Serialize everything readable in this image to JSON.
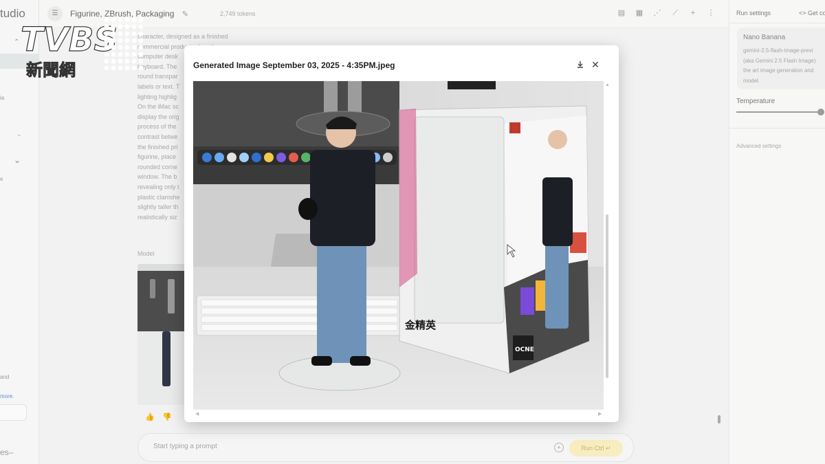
{
  "app": {
    "brand": "tudio",
    "title": "Figurine, ZBrush, Packaging",
    "tokens": "2,749 tokens"
  },
  "left_nav": {
    "fragments": [
      "ia",
      "e",
      "and",
      "more."
    ],
    "bottom": "es–"
  },
  "chat": {
    "lines": [
      "character, designed as a finished",
      "commercial product, placed on a",
      "computer desk",
      "keyboard. The",
      "round transpar",
      "labels or text. T",
      "lighting highlig",
      "On the iMac sc",
      "display the orig",
      "process of the",
      "contrast betwe",
      "the finished pri",
      "figurine, place",
      "rounded corne",
      "window. The b",
      "revealing only t",
      "plastic clamshe",
      "slightly taller th",
      "realistically siz"
    ],
    "model_label": "Model",
    "prompt_placeholder": "Start typing a prompt",
    "run_label": "Run  Ctrl ↵"
  },
  "run_settings": {
    "header": "Run settings",
    "get_code": "<> Get co",
    "model_name": "Nano Banana",
    "model_desc": [
      "gemini-2.5-flash-image-previ",
      "(aka Gemini 2.5 Flash Image)",
      "the art image generation and",
      "model."
    ],
    "temperature_label": "Temperature",
    "temperature_fraction": 1.0,
    "advanced": "Advanced settings"
  },
  "modal": {
    "title": "Generated Image September 03, 2025 - 4:35PM.jpeg"
  },
  "image": {
    "box_logo_text": "金精英",
    "box_badge_text": "OCNE"
  },
  "watermark": {
    "logo": "TVBS",
    "subtitle": "新聞網"
  },
  "colors": {
    "accent_run": "#f7edbf",
    "modal_bg": "#ffffff",
    "panel_bg": "#f7f7f6"
  }
}
